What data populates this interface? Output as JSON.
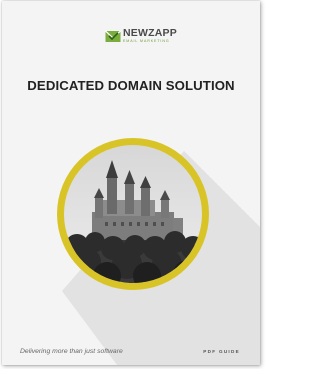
{
  "brand": {
    "name": "NEWZAPP",
    "subtitle": "EMAIL MARKETING",
    "icon": "envelope-check-icon",
    "accent_color": "#6a9c3a"
  },
  "cover": {
    "title": "DEDICATED DOMAIN SOLUTION",
    "image": "castle-photo",
    "ring_color": "#d9c428",
    "tagline": "Delivering more than just software",
    "doc_type": "PDF GUIDE"
  }
}
